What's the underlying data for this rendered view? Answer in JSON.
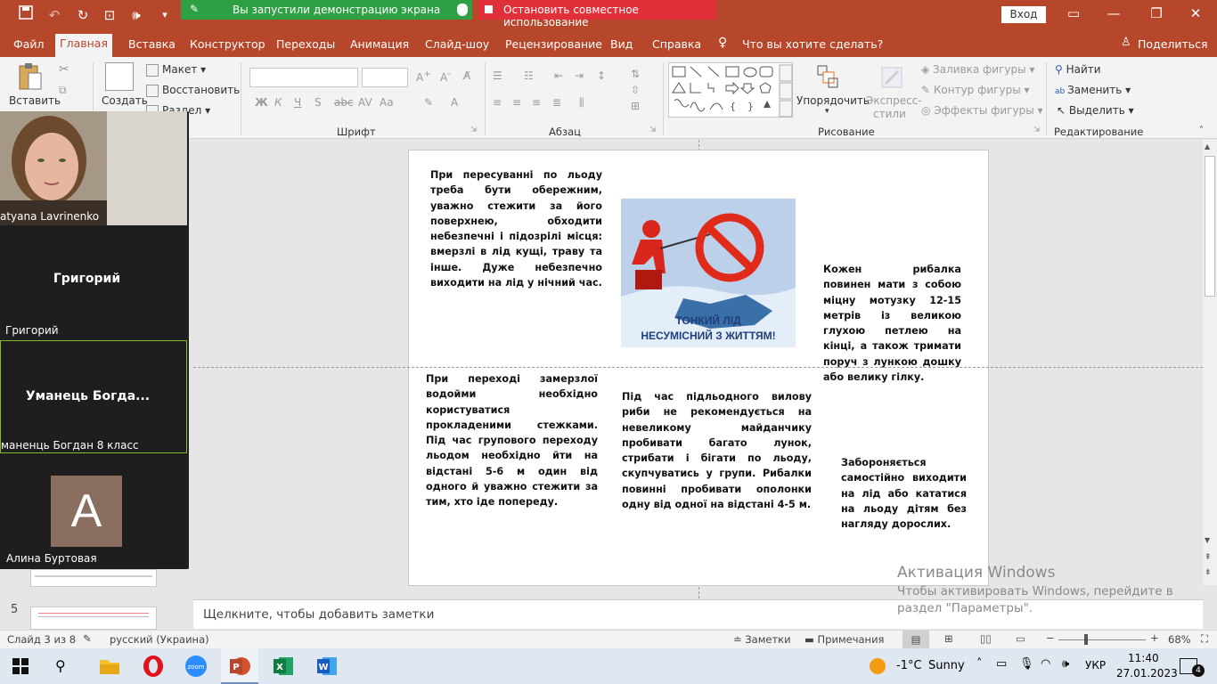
{
  "title_bar": {
    "share_notice": "Вы запустили демонстрацию экрана",
    "stop_sharing": "Остановить совместное использование",
    "signin": "Вход"
  },
  "menu": {
    "items": [
      "Файл",
      "Главная",
      "Вставка",
      "Конструктор",
      "Переходы",
      "Анимация",
      "Слайд-шоу",
      "Рецензирование",
      "Вид",
      "Справка"
    ],
    "tell_me": "Что вы хотите сделать?",
    "share": "Поделиться"
  },
  "ribbon": {
    "paste": "Вставить",
    "create": "Создать",
    "layout": "Макет",
    "reset": "Восстановить",
    "section": "Раздел",
    "font_group": "Шрифт",
    "paragraph_group": "Абзац",
    "drawing_group": "Рисование",
    "editing_group": "Редактирование",
    "arrange": "Упорядочить",
    "quick_styles_1": "Экспресс-",
    "quick_styles_2": "стили",
    "shape_fill": "Заливка фигуры",
    "shape_outline": "Контур фигуры",
    "shape_effects": "Эффекты фигуры",
    "find": "Найти",
    "replace": "Заменить",
    "select": "Выделить",
    "font_buttons": [
      "Ж",
      "К",
      "Ч",
      "S",
      "Аа",
      "А"
    ]
  },
  "zoom_participants": [
    {
      "name": "Tatyana Lavrinenko",
      "shown_name": "atyana Lavrinenko"
    },
    {
      "tile_title": "Григорий",
      "name": "Григорий"
    },
    {
      "tile_title": "Уманець  Богда...",
      "name": "маненць Богдан 8 класс"
    },
    {
      "avatar_letter": "A",
      "name": "Алина Буртовая"
    }
  ],
  "thumbnail": {
    "number": "5"
  },
  "slide": {
    "text_top_left": "При пересуванні по льоду треба бути обережним, уважно стежити за його поверхнею, обходити небезпечні і підозрілі місця: вмерзлі в лід кущі, траву та інше. Дуже небезпечно виходити на лід у нічний час.",
    "image_caption_1": "ТОНКИЙ ЛІД",
    "image_caption_2": "НЕСУМІСНИЙ З ЖИТТЯМ!",
    "text_right_top": "Кожен рибалка повинен мати з собою міцну мотузку 12-15 метрів із великою глухою петлею на кінці, а також тримати поруч з лункою дошку або велику гілку.",
    "text_bottom_left": "При переході замерзлої водойми необхідно користуватися прокладеними стежками. Під час групового переходу льодом необхідно йти на відстані 5-6 м один від одного й уважно стежити за тим, хто іде попереду.",
    "text_bottom_mid": "Під час підльодного вилову риби не рекомендується на невеликому майданчику пробивати багато лунок, стрибати і бігати по льоду, скупчуватись у групи. Рибалки повинні пробивати ополонки одну від одної на відстані 4-5 м.",
    "text_bottom_right": "Забороняється самостійно виходити на лід або кататися на льоду дітям без нагляду дорослих."
  },
  "notes_placeholder": "Щелкните, чтобы добавить заметки",
  "activation": {
    "title": "Активация Windows",
    "line1": "Чтобы активировать Windows, перейдите в",
    "line2": "раздел \"Параметры\"."
  },
  "status": {
    "slide": "Слайд 3 из 8",
    "language": "русский (Украина)",
    "notes": "Заметки",
    "comments": "Примечания",
    "zoom": "68%"
  },
  "taskbar": {
    "temp": "-1°C",
    "weather": "Sunny",
    "lang": "УКР",
    "time": "11:40",
    "date": "27.01.2023",
    "notif_count": "4"
  },
  "colors": {
    "accent": "#b7472a",
    "share_green": "#2ea043",
    "stop_red": "#e0303a",
    "zoom_dark": "#1e1e1e"
  }
}
